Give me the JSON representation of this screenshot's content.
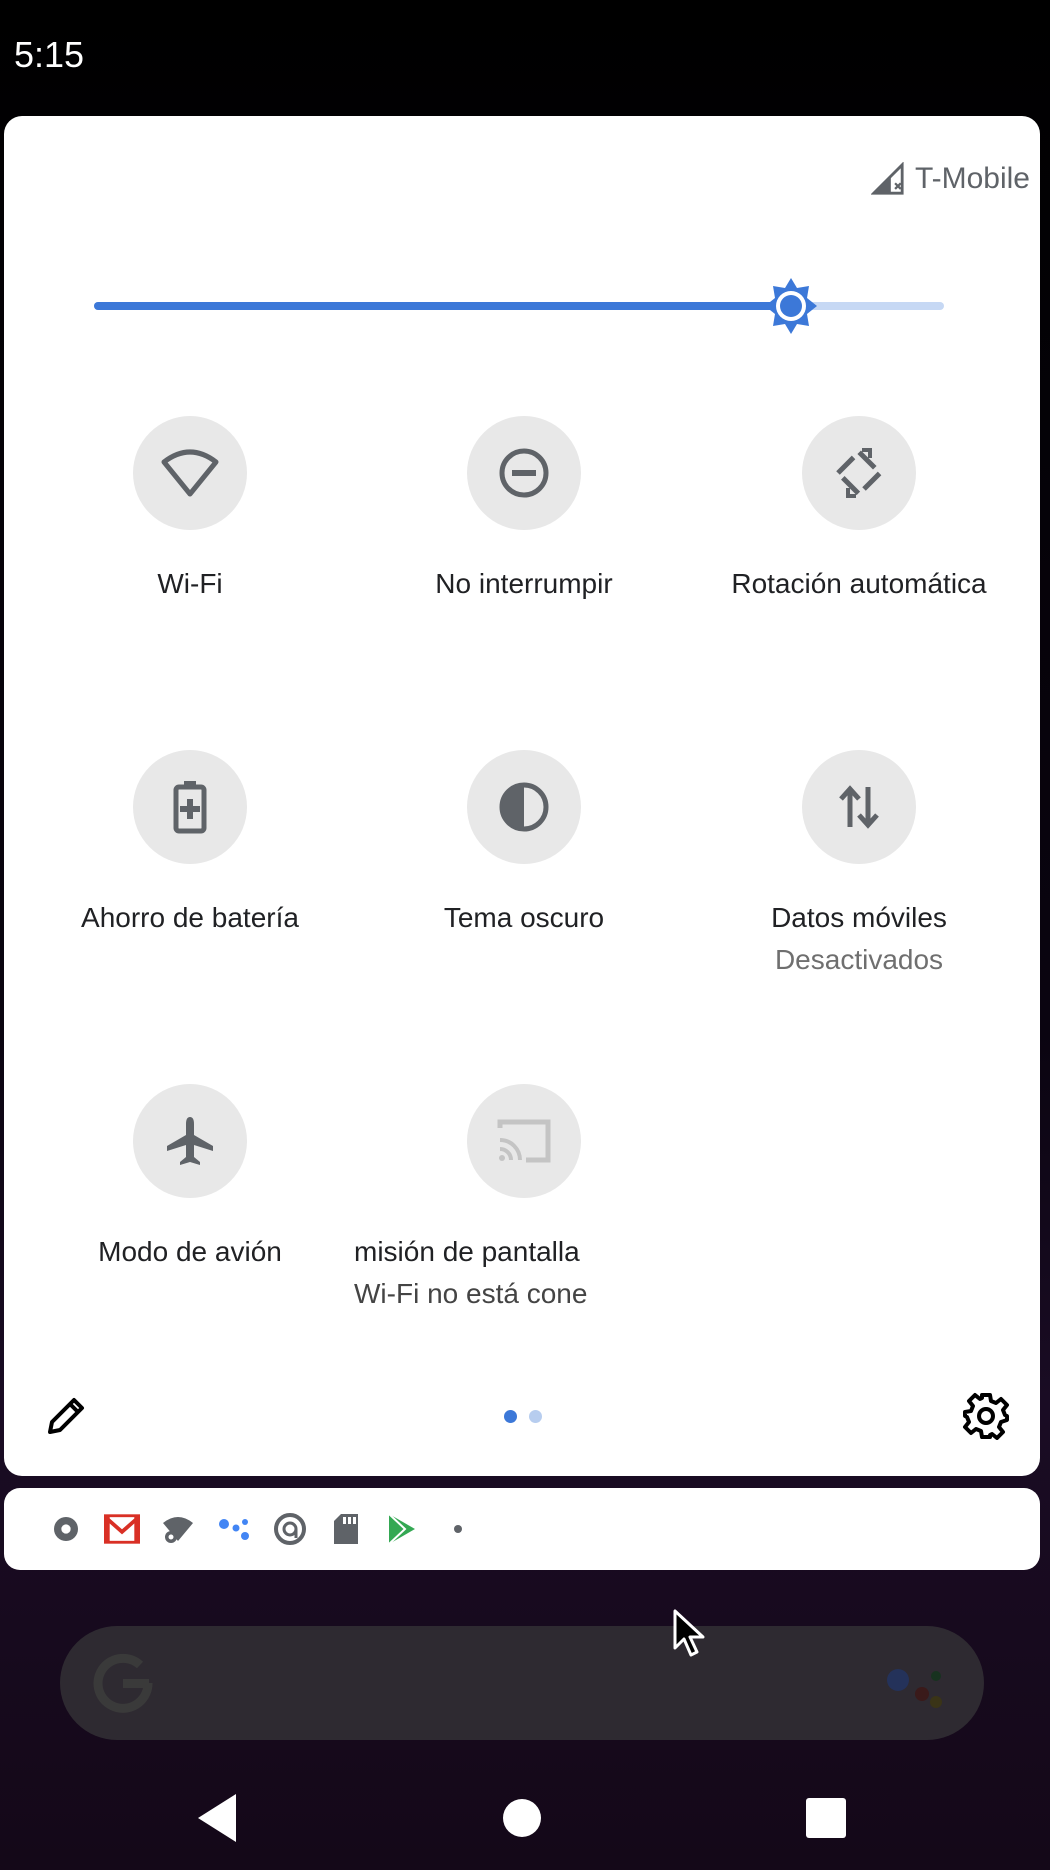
{
  "status_bar": {
    "time": "5:15"
  },
  "quick_settings": {
    "carrier": "T-Mobile",
    "brightness": {
      "level": 0.82,
      "accent_color": "#3c78d8"
    },
    "tiles": [
      {
        "label": "Wi-Fi",
        "sublabel": "",
        "icon": "wifi-icon"
      },
      {
        "label": "No interrumpir",
        "sublabel": "",
        "icon": "do-not-disturb-icon"
      },
      {
        "label": "Rotación automática",
        "sublabel": "",
        "icon": "auto-rotate-icon"
      },
      {
        "label": "Ahorro de batería",
        "sublabel": "",
        "icon": "battery-saver-icon"
      },
      {
        "label": "Tema oscuro",
        "sublabel": "",
        "icon": "dark-theme-icon"
      },
      {
        "label": "Datos móviles",
        "sublabel": "Desactivados",
        "icon": "mobile-data-icon"
      },
      {
        "label": "Modo de avión",
        "sublabel": "",
        "icon": "airplane-icon"
      },
      {
        "label": "misión de pantalla",
        "sublabel": "Wi-Fi no está cone",
        "icon": "cast-icon"
      }
    ],
    "footer": {
      "page_count": 2,
      "current_page": 1
    }
  },
  "notification_icons": [
    "settings-icon",
    "gmail-icon",
    "wifi-settings-icon",
    "assistant-dots-icon",
    "vpn-icon",
    "sd-card-icon",
    "play-store-icon",
    "more-dot-icon"
  ],
  "search_bar": {
    "logo": "google-g-logo",
    "assistant": "google-assistant-icon"
  },
  "nav_bar": {
    "buttons": [
      "back-button",
      "home-button",
      "recents-button"
    ]
  }
}
